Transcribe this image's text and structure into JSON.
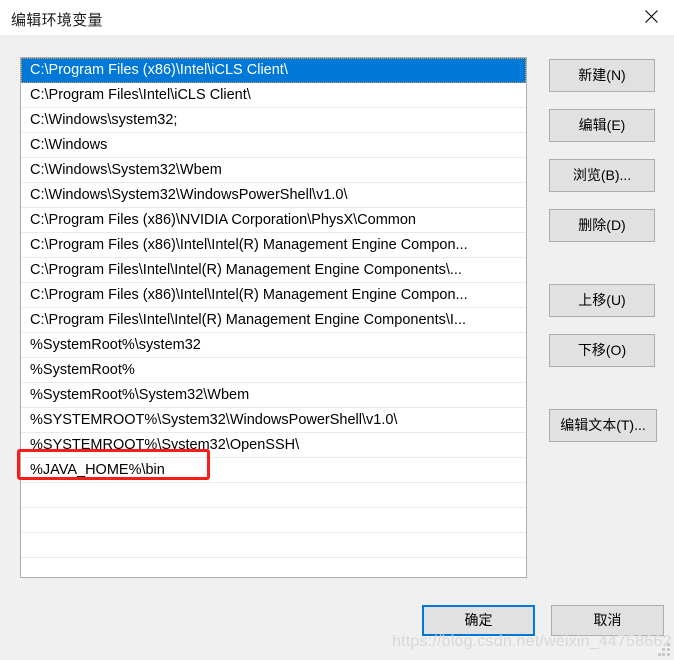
{
  "window": {
    "title": "编辑环境变量",
    "close_icon": "close-icon"
  },
  "list": {
    "selected_index": 0,
    "items": [
      "C:\\Program Files (x86)\\Intel\\iCLS Client\\",
      "C:\\Program Files\\Intel\\iCLS Client\\",
      "C:\\Windows\\system32;",
      "C:\\Windows",
      "C:\\Windows\\System32\\Wbem",
      "C:\\Windows\\System32\\WindowsPowerShell\\v1.0\\",
      "C:\\Program Files (x86)\\NVIDIA Corporation\\PhysX\\Common",
      "C:\\Program Files (x86)\\Intel\\Intel(R) Management Engine Compon...",
      "C:\\Program Files\\Intel\\Intel(R) Management Engine Components\\...",
      "C:\\Program Files (x86)\\Intel\\Intel(R) Management Engine Compon...",
      "C:\\Program Files\\Intel\\Intel(R) Management Engine Components\\I...",
      "%SystemRoot%\\system32",
      "%SystemRoot%",
      "%SystemRoot%\\System32\\Wbem",
      "%SYSTEMROOT%\\System32\\WindowsPowerShell\\v1.0\\",
      "%SYSTEMROOT%\\System32\\OpenSSH\\",
      "%JAVA_HOME%\\bin"
    ],
    "empty_row_count": 4,
    "highlight_annotation": {
      "target_item": "%JAVA_HOME%\\bin",
      "color": "#fb1c19"
    }
  },
  "side_buttons": {
    "new": "新建(N)",
    "edit": "编辑(E)",
    "browse": "浏览(B)...",
    "delete": "删除(D)",
    "move_up": "上移(U)",
    "move_down": "下移(O)",
    "edit_text": "编辑文本(T)..."
  },
  "footer": {
    "ok": "确定",
    "cancel": "取消"
  },
  "watermark": {
    "text": "https://blog.csdn.net/weixin_44758662"
  },
  "colors": {
    "selection": "#0078d7",
    "dialog_background": "#f0f0f0",
    "button_face": "#e1e1e1",
    "annotation": "#fb1c19"
  }
}
